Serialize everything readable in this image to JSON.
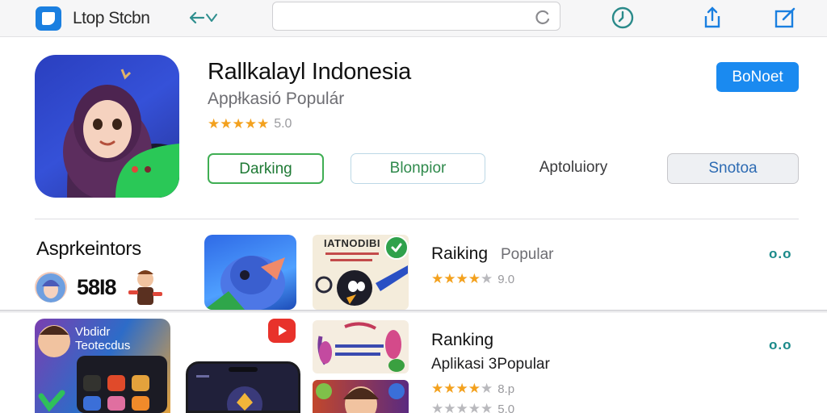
{
  "topbar": {
    "app_name": "Ltop Stcbn",
    "search_value": "",
    "search_placeholder": ""
  },
  "hero": {
    "title": "Rallkalayl Indonesia",
    "subtitle": "Appłkasió Populár",
    "rating_value": "5.0",
    "stars_filled": 5,
    "primary_button": "BoNoet",
    "chips": [
      "Darking",
      "Blonpior",
      "Aptoluiory",
      "Snotoa"
    ]
  },
  "section": {
    "title": "Asprkeintors",
    "mini_label": "58I8",
    "card_b_title": "IATNODIBI"
  },
  "rows": [
    {
      "title": "Raiking",
      "subtitle": "Popular",
      "rating": "9.0",
      "more": "o.o"
    },
    {
      "title": "Ranking",
      "subtitle": "Aplikasi 3Popular",
      "rating": "8.p",
      "rating2": "5.0",
      "more": "o.o"
    }
  ],
  "lower": {
    "card_c_title": "Vbdidr\nTeotecdus"
  },
  "colors": {
    "accent": "#1a8af0",
    "star": "#f3a11e",
    "chip_green": "#3fae53",
    "more": "#1a8a8a"
  },
  "icons": [
    "back-forward-icon",
    "refresh-icon",
    "history-icon",
    "share-icon",
    "edit-icon",
    "check-icon",
    "play-icon"
  ]
}
